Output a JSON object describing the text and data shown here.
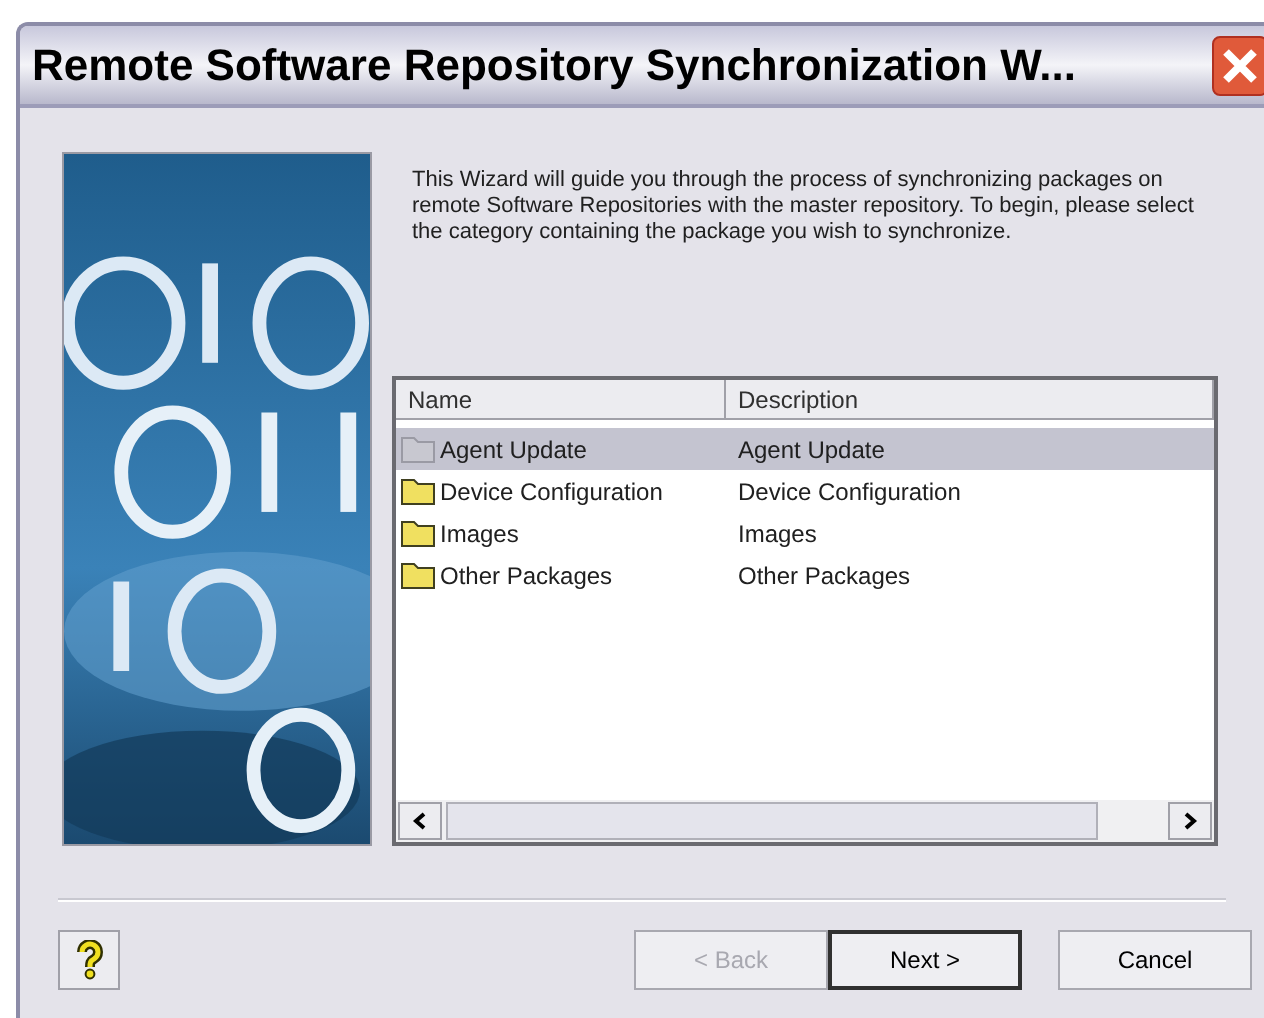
{
  "window": {
    "title": "Remote Software Repository Synchronization W..."
  },
  "intro": "This Wizard will guide you through the process of synchronizing packages on remote Software Repositories with the master repository. To begin, please select the category containing the package you wish to synchronize.",
  "table": {
    "columns": [
      "Name",
      "Description"
    ],
    "rows": [
      {
        "name": "Agent Update",
        "description": "Agent Update",
        "selected": true
      },
      {
        "name": "Device Configuration",
        "description": "Device Configuration",
        "selected": false
      },
      {
        "name": "Images",
        "description": "Images",
        "selected": false
      },
      {
        "name": "Other Packages",
        "description": "Other Packages",
        "selected": false
      }
    ]
  },
  "buttons": [
    {
      "label": "< Back",
      "disabled": true,
      "default": false
    },
    {
      "label": "Next >",
      "disabled": false,
      "default": true
    },
    {
      "label": "Cancel",
      "disabled": false,
      "default": false
    }
  ]
}
